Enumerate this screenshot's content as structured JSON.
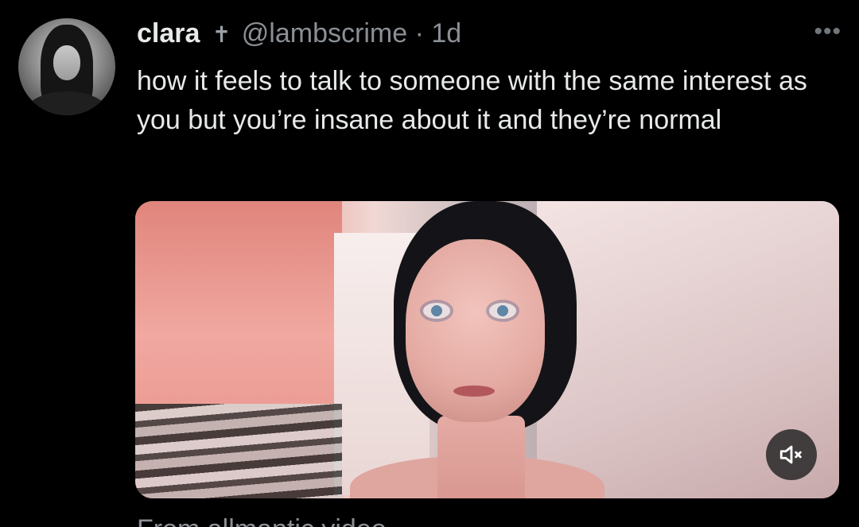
{
  "tweet": {
    "author": {
      "display_name": "clara",
      "emblem": "✝",
      "handle": "@lambscrime",
      "separator": "·",
      "time": "1d"
    },
    "more_label": "•••",
    "text": "how it feels to talk to someone with the same interest as you but you’re insane about it and they’re normal",
    "media": {
      "type": "video",
      "muted": true,
      "mute_icon": "speaker-muted-icon"
    },
    "below_media_partial": "From  allmantic  video"
  },
  "colors": {
    "background": "#000000",
    "text": "#e7e9ea",
    "secondary": "#8b9096"
  }
}
